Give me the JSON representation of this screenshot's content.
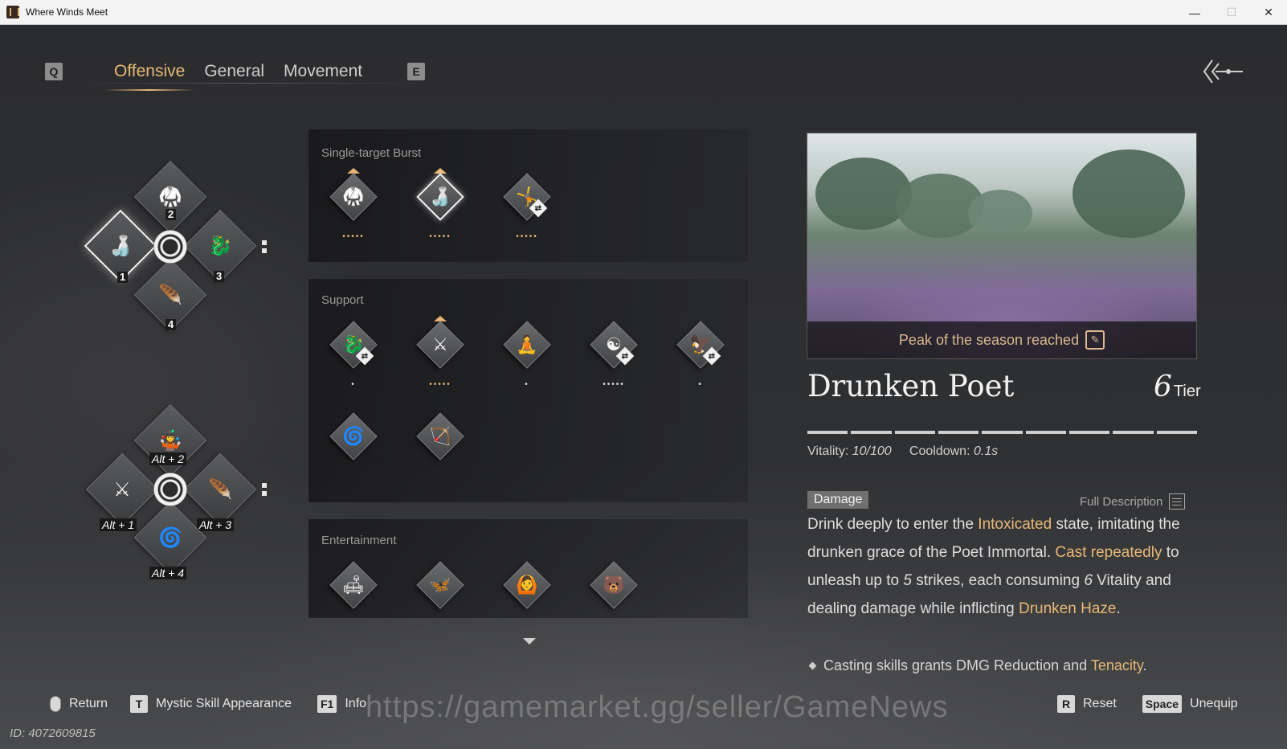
{
  "window": {
    "title": "Where Winds Meet",
    "controls": [
      "—",
      "☐",
      "✕"
    ]
  },
  "tabs": {
    "prev_key": "Q",
    "next_key": "E",
    "items": [
      {
        "label": "Offensive",
        "active": true
      },
      {
        "label": "General",
        "active": false
      },
      {
        "label": "Movement",
        "active": false
      }
    ]
  },
  "wheel_top": {
    "slots": [
      {
        "num": "2",
        "icon": "martial-pose-icon"
      },
      {
        "num": "1",
        "icon": "drunken-poet-icon"
      },
      {
        "num": "3",
        "icon": "leap-icon"
      },
      {
        "num": "4",
        "icon": "wing-strike-icon"
      }
    ]
  },
  "wheel_bottom": {
    "slots": [
      {
        "num": "Alt + 2",
        "icon": "juggle-icon"
      },
      {
        "num": "Alt + 1",
        "icon": "crossed-blades-icon"
      },
      {
        "num": "Alt + 3",
        "icon": "feather-icon"
      },
      {
        "num": "Alt + 4",
        "icon": "swoop-icon"
      }
    ]
  },
  "panels": {
    "burst": {
      "title": "Single-target Burst",
      "skills": [
        {
          "icon": "martial-pose-icon",
          "dots": "•••••",
          "lit": 1,
          "tier_mark": true,
          "swap": false
        },
        {
          "icon": "drunken-poet-icon",
          "dots": "•••••",
          "lit": 1,
          "tier_mark": true,
          "swap": false,
          "selected": true
        },
        {
          "icon": "dancer-icon",
          "dots": "•••••",
          "lit": 1,
          "tier_mark": false,
          "swap": true
        }
      ]
    },
    "support": {
      "title": "Support",
      "skills": [
        {
          "icon": "leap-icon",
          "dots": "•",
          "swap": true
        },
        {
          "icon": "crossed-blades-icon",
          "dots": "•••••",
          "lit": 1,
          "tier_mark": true
        },
        {
          "icon": "meditate-icon",
          "dots": "•"
        },
        {
          "icon": "yin-yang-icon",
          "dots": "•••••",
          "swap": true
        },
        {
          "icon": "eagle-icon",
          "dots": "•",
          "swap": true
        },
        {
          "icon": "spiral-icon",
          "dots": ""
        },
        {
          "icon": "archer-icon",
          "dots": ""
        }
      ]
    },
    "entertainment": {
      "title": "Entertainment",
      "skills": [
        {
          "icon": "recline-icon"
        },
        {
          "icon": "dragonfly-icon"
        },
        {
          "icon": "vitruvian-icon"
        },
        {
          "icon": "bear-icon"
        }
      ]
    }
  },
  "detail": {
    "preview_caption": "Peak of the season reached",
    "name": "Drunken Poet",
    "tier_num": "6",
    "tier_label": "Tier",
    "tier_segments": 9,
    "vitality_label": "Vitality:",
    "vitality_value": "10/100",
    "cooldown_label": "Cooldown:",
    "cooldown_value": "0.1s",
    "badge": "Damage",
    "full_desc": "Full Description",
    "desc": {
      "t1": "Drink deeply to enter the ",
      "h1": "Intoxicated",
      "t2": " state, imitating the drunken grace of the Poet Immortal. ",
      "h2": "Cast repeatedly",
      "t3": " to unleash up to ",
      "n1": "5",
      "t4": " strikes, each consuming ",
      "n2": "6",
      "t5": " Vitality and dealing damage while inflicting ",
      "h3": "Drunken Haze",
      "t6": "."
    },
    "bullet": {
      "t1": "Casting skills grants DMG Reduction and ",
      "h1": "Tenacity",
      "t2": "."
    }
  },
  "bottom": {
    "return_label": "Return",
    "appearance_key": "T",
    "appearance_label": "Mystic Skill Appearance",
    "info_key": "F1",
    "info_label": "Info",
    "reset_key": "R",
    "reset_label": "Reset",
    "unequip_key": "Space",
    "unequip_label": "Unequip",
    "watermark": "https://gamemarket.gg/seller/GameNews",
    "id_text": "ID: 4072609815"
  }
}
